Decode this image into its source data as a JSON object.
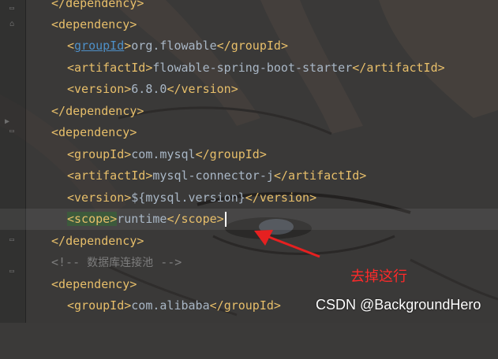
{
  "editor": {
    "lines": [
      {
        "close": "dependency"
      },
      {
        "open": "dependency"
      },
      {
        "tag": "groupId",
        "value": "org.flowable"
      },
      {
        "tag": "artifactId",
        "value": "flowable-spring-boot-starter"
      },
      {
        "tag": "version",
        "value": "6.8.0"
      },
      {
        "close": "dependency"
      },
      {
        "open": "dependency"
      },
      {
        "tag": "groupId",
        "value": "com.mysql"
      },
      {
        "tag": "artifactId",
        "value": "mysql-connector-j"
      },
      {
        "tag": "version",
        "value": "${mysql.version}"
      },
      {
        "tag": "scope",
        "value": "runtime"
      },
      {
        "close": "dependency"
      },
      {
        "comment_open": "<!--",
        "comment_text": "数据库连接池",
        "comment_close": "-->"
      },
      {
        "open": "dependency"
      },
      {
        "tag": "groupId",
        "value": "com.alibaba"
      }
    ]
  },
  "annotation": {
    "text": "去掉这行",
    "color": "#ff2a2a"
  },
  "watermark": {
    "text": "CSDN @BackgroundHero"
  },
  "colors": {
    "tag": "#e8bf6a",
    "text": "#a9b7c6",
    "comment": "#7d7d7d",
    "background": "#3b3a39"
  }
}
